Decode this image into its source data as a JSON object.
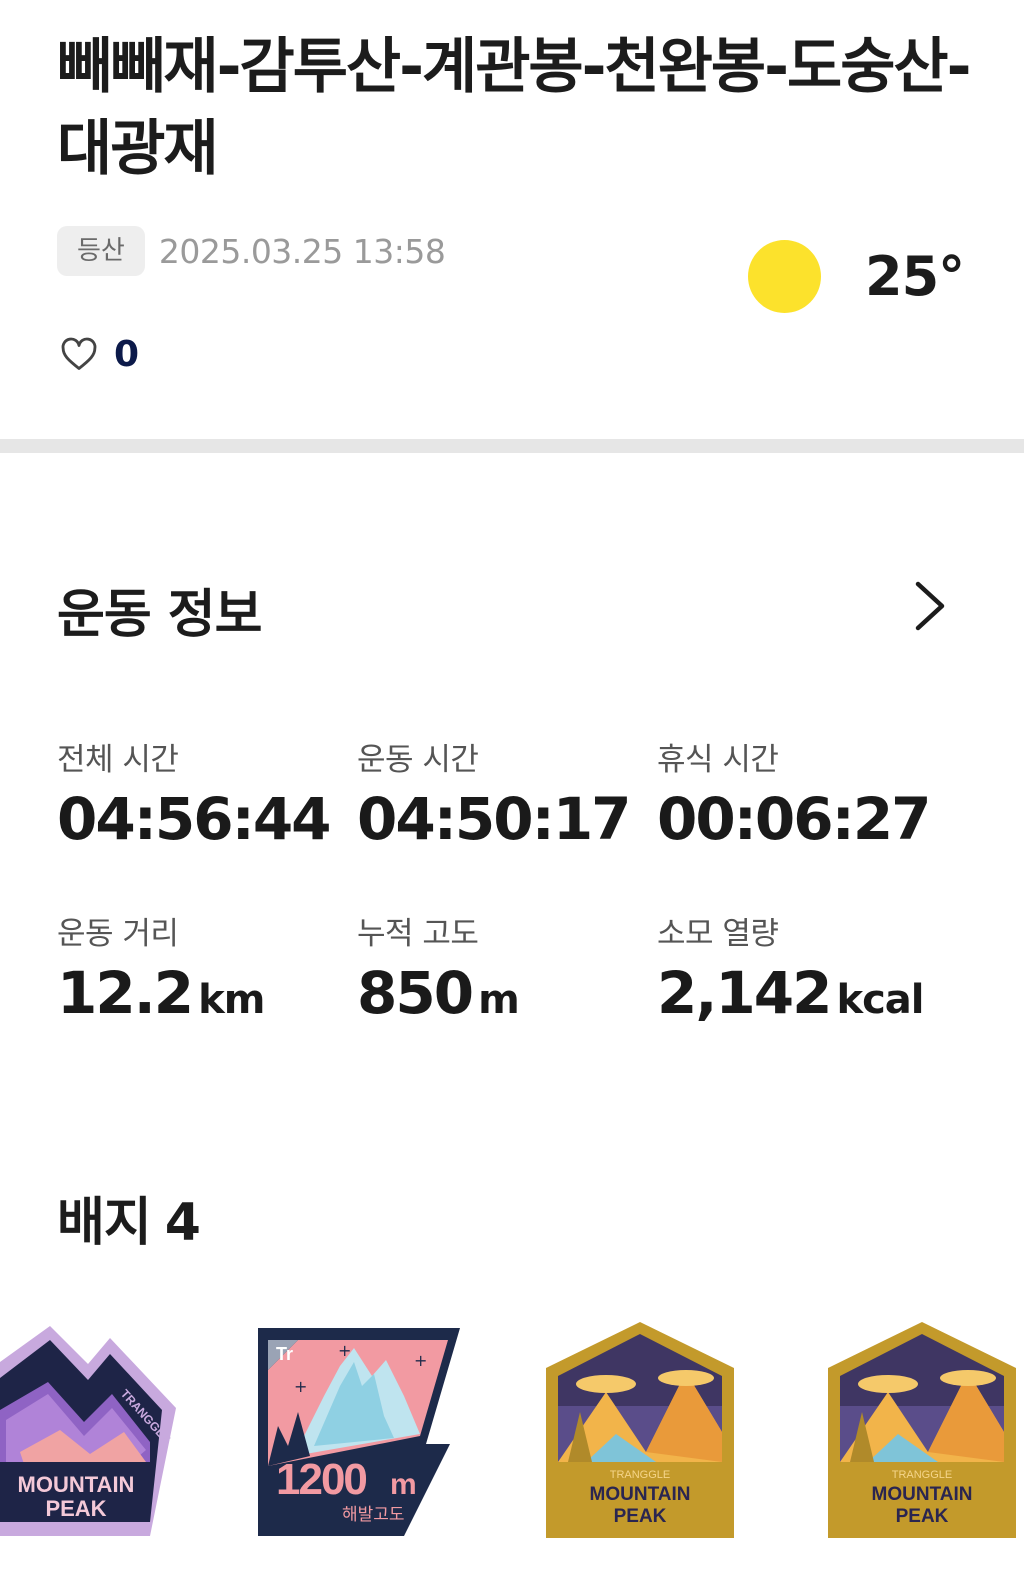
{
  "title": "빼빼재-감투산-계관봉-천완봉-도숭산-대광재",
  "meta": {
    "tag": "등산",
    "datetime": "2025.03.25 13:58"
  },
  "weather": {
    "temperature": "25°",
    "icon": "sun-icon",
    "sun_color": "#fce22c"
  },
  "likes": {
    "icon": "heart-icon",
    "count": "0"
  },
  "exercise": {
    "section_title": "운동 정보",
    "stats": [
      {
        "label": "전체 시간",
        "value": "04:56:44",
        "unit": ""
      },
      {
        "label": "운동 시간",
        "value": "04:50:17",
        "unit": ""
      },
      {
        "label": "휴식 시간",
        "value": "00:06:27",
        "unit": ""
      },
      {
        "label": "운동 거리",
        "value": "12.2",
        "unit": "km"
      },
      {
        "label": "누적 고도",
        "value": "850",
        "unit": "m"
      },
      {
        "label": "소모 열량",
        "value": "2,142",
        "unit": "kcal"
      }
    ]
  },
  "badges": {
    "title": "배지",
    "count": "4",
    "items": [
      {
        "icon": "mountain-peak-badge-purple",
        "brand": "TRANGGLE",
        "line1": "MOUNTAIN",
        "line2": "PEAK"
      },
      {
        "icon": "altitude-1200m-badge",
        "brand": "Tr",
        "value": "1200",
        "unit": "m",
        "caption": "해발고도"
      },
      {
        "icon": "mountain-peak-badge-gold",
        "brand": "TRANGGLE",
        "line1": "MOUNTAIN",
        "line2": "PEAK"
      },
      {
        "icon": "mountain-peak-badge-gold",
        "brand": "TRANGGLE",
        "line1": "MOUNTAIN",
        "line2": "PEAK"
      }
    ]
  }
}
